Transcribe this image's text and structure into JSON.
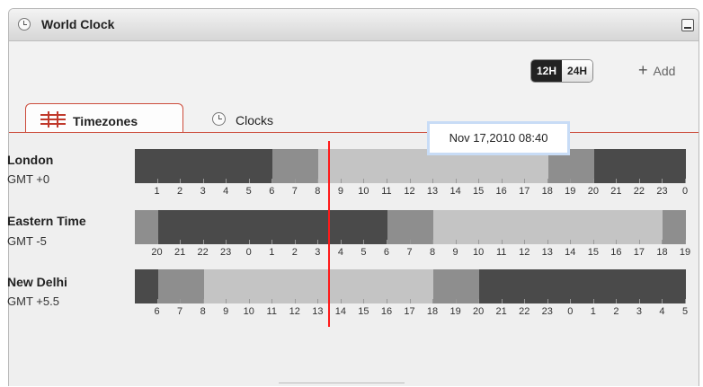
{
  "widget": {
    "title": "World Clock",
    "title_icon": "clock-icon",
    "minimize_icon": "minimize-icon"
  },
  "toolbar": {
    "format_12h": "12H",
    "format_24h": "24H",
    "selected_format": "12H",
    "add_label": "Add",
    "add_icon": "plus-icon"
  },
  "tabs": [
    {
      "label": "Timezones",
      "icon": "timezones-grid-icon",
      "selected": true
    },
    {
      "label": "Clocks",
      "icon": "clock-icon",
      "selected": false
    }
  ],
  "tooltip": "Nov 17,2010 08:40",
  "zones": [
    {
      "name": "London",
      "offset": "GMT +0",
      "hours": [
        "1",
        "2",
        "3",
        "4",
        "5",
        "6",
        "7",
        "8",
        "9",
        "10",
        "11",
        "12",
        "13",
        "14",
        "15",
        "16",
        "17",
        "18",
        "19",
        "20",
        "21",
        "22",
        "23",
        "0"
      ]
    },
    {
      "name": "Eastern Time",
      "offset": "GMT -5",
      "hours": [
        "20",
        "21",
        "22",
        "23",
        "0",
        "1",
        "2",
        "3",
        "4",
        "5",
        "6",
        "7",
        "8",
        "9",
        "10",
        "11",
        "12",
        "13",
        "14",
        "15",
        "16",
        "17",
        "18",
        "19"
      ]
    },
    {
      "name": "New Delhi",
      "offset": "GMT +5.5",
      "hours": [
        "6",
        "7",
        "8",
        "9",
        "10",
        "11",
        "12",
        "13",
        "14",
        "15",
        "16",
        "17",
        "18",
        "19",
        "20",
        "21",
        "22",
        "23",
        "0",
        "1",
        "2",
        "3",
        "4",
        "5"
      ]
    }
  ],
  "colors": {
    "night": "#4a4a4a",
    "twilight": "#8e8e8e",
    "day": "#c4c4c4",
    "current_time_line": "#ff1a1a",
    "tab_accent": "#cc4b3a"
  }
}
